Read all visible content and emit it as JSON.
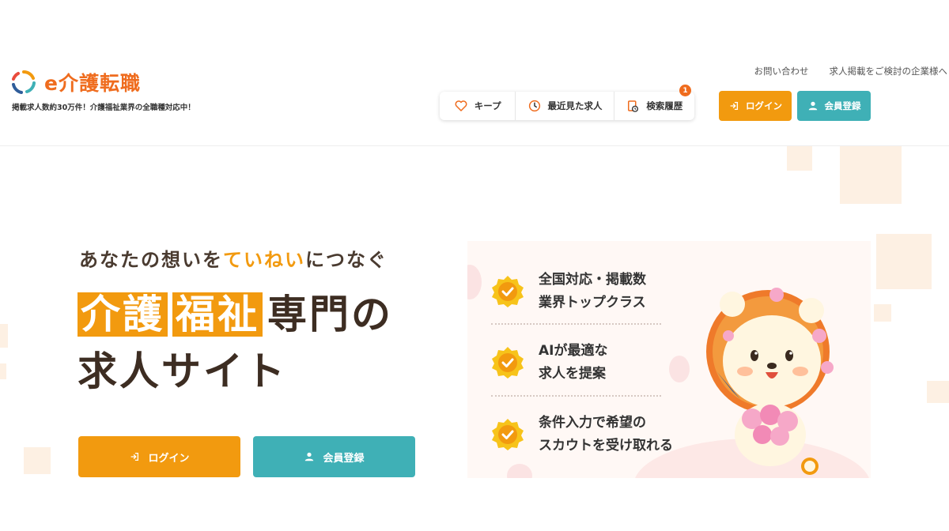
{
  "header": {
    "logo_text": "e介護転職",
    "tagline": "掲載求人数約30万件！介護福祉業界の全職種対応中！",
    "top_links": [
      "お問い合わせ",
      "求人掲載をご検討の企業様へ"
    ],
    "nav": [
      {
        "label": "キープ",
        "icon": "heart-icon"
      },
      {
        "label": "最近見た求人",
        "icon": "clock-icon"
      },
      {
        "label": "検索履歴",
        "icon": "history-icon",
        "badge": "1"
      }
    ],
    "login_label": "ログイン",
    "register_label": "会員登録"
  },
  "hero": {
    "catchcopy_pre": "あなたの想いを",
    "catchcopy_highlight": "ていねい",
    "catchcopy_post": "につなぐ",
    "title_box1": "介護",
    "title_box2": "福祉",
    "title_rest1": "専門の",
    "title_line2": "求人サイト",
    "login_label": "ログイン",
    "register_label": "会員登録"
  },
  "features": [
    {
      "line1": "全国対応・掲載数",
      "line2": "業界トップクラス"
    },
    {
      "line1": "AIが最適な",
      "line2": "求人を提案"
    },
    {
      "line1": "条件入力で希望の",
      "line2": "スカウトを受け取れる"
    }
  ],
  "colors": {
    "accent_orange": "#f29a0f",
    "logo_orange": "#ef6c1e",
    "teal": "#3fb0b6",
    "text_dark": "#3d2d22"
  }
}
